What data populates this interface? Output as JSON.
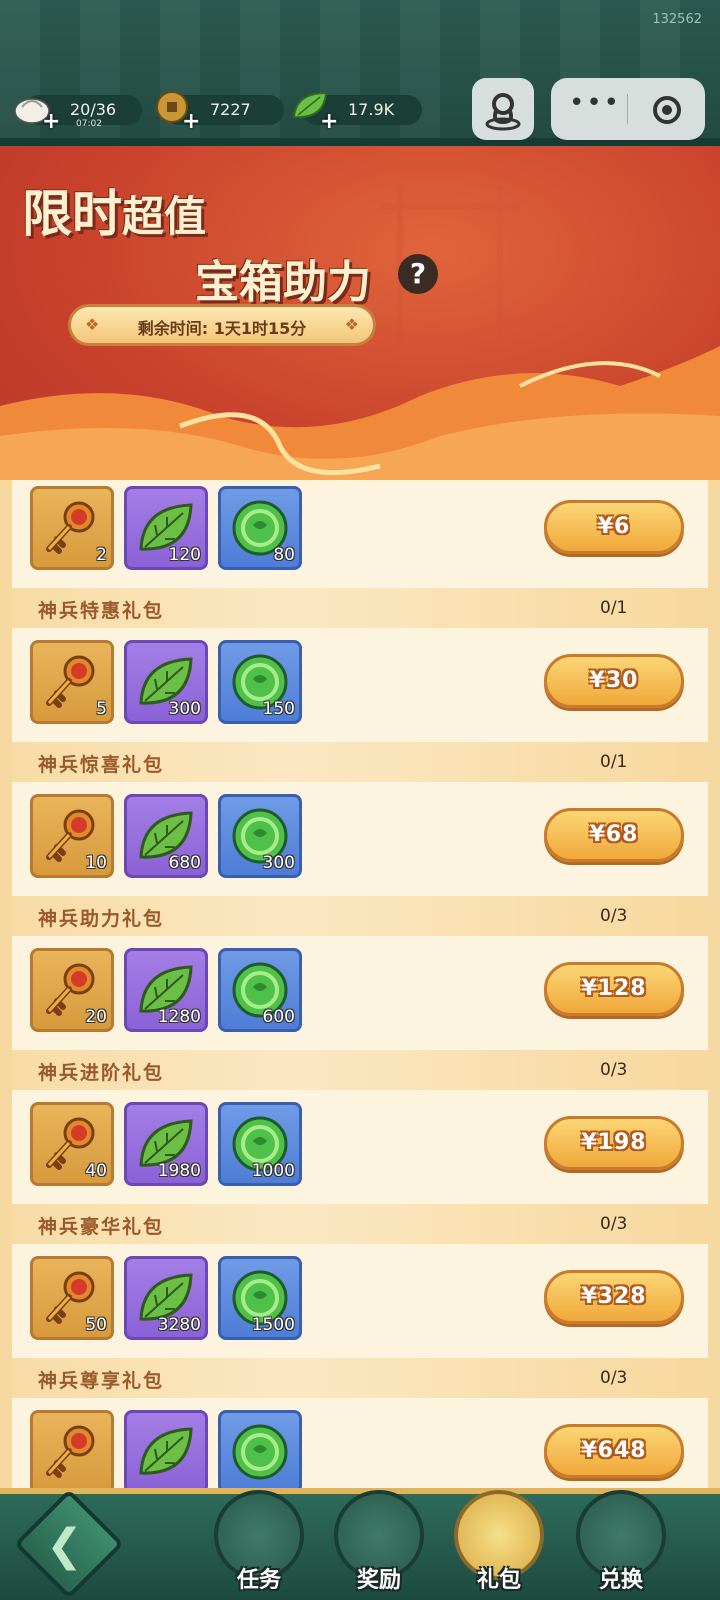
{
  "uid": "132562",
  "resources": [
    {
      "name": "stamina",
      "value": "20/36",
      "sub": "07:02",
      "icon": "bun-icon"
    },
    {
      "name": "coins",
      "value": "7227",
      "icon": "coin-icon"
    },
    {
      "name": "leaves",
      "value": "17.9K",
      "icon": "leaf-icon"
    }
  ],
  "banner": {
    "title_a": "限时",
    "title_b": "超值",
    "title_line2": "宝箱助力",
    "help": "?",
    "timer_text": "剩余时间: 1天1时15分"
  },
  "packs": [
    {
      "name": "",
      "count": "",
      "items": [
        "2",
        "120",
        "80"
      ],
      "price": "¥6"
    },
    {
      "name": "神兵特惠礼包",
      "count": "0/1",
      "items": [
        "5",
        "300",
        "150"
      ],
      "price": "¥30"
    },
    {
      "name": "神兵惊喜礼包",
      "count": "0/1",
      "items": [
        "10",
        "680",
        "300"
      ],
      "price": "¥68"
    },
    {
      "name": "神兵助力礼包",
      "count": "0/3",
      "items": [
        "20",
        "1280",
        "600"
      ],
      "price": "¥128"
    },
    {
      "name": "神兵进阶礼包",
      "count": "0/3",
      "items": [
        "40",
        "1980",
        "1000"
      ],
      "price": "¥198"
    },
    {
      "name": "神兵豪华礼包",
      "count": "0/3",
      "items": [
        "50",
        "3280",
        "1500"
      ],
      "price": "¥328"
    },
    {
      "name": "神兵尊享礼包",
      "count": "0/3",
      "items": [
        "",
        "",
        ""
      ],
      "price": "¥648"
    }
  ],
  "nav": [
    {
      "label": "任务",
      "icon": "scroll-icon",
      "active": false
    },
    {
      "label": "奖励",
      "icon": "reward-box-icon",
      "active": false
    },
    {
      "label": "礼包",
      "icon": "gift-bag-icon",
      "active": true
    },
    {
      "label": "兑换",
      "icon": "exchange-icon",
      "active": false
    }
  ]
}
